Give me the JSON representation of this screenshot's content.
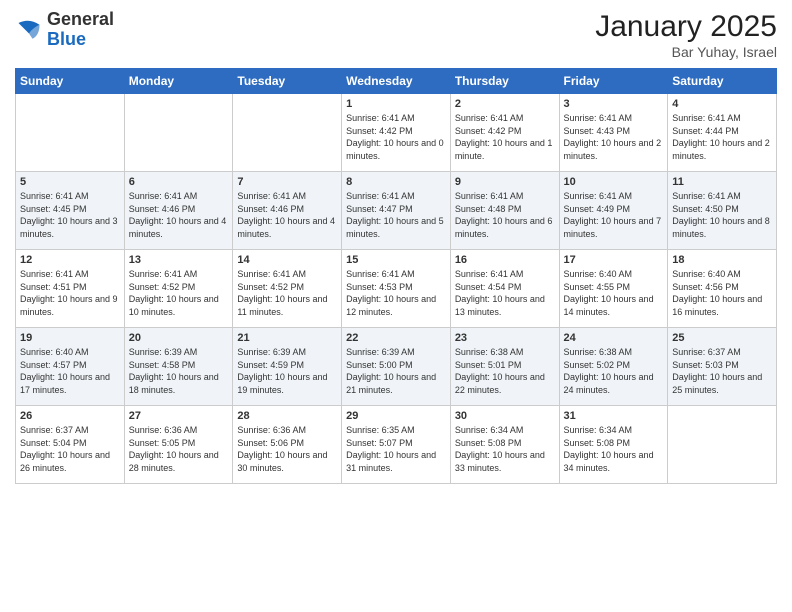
{
  "logo": {
    "general": "General",
    "blue": "Blue"
  },
  "header": {
    "title": "January 2025",
    "subtitle": "Bar Yuhay, Israel"
  },
  "weekdays": [
    "Sunday",
    "Monday",
    "Tuesday",
    "Wednesday",
    "Thursday",
    "Friday",
    "Saturday"
  ],
  "weeks": [
    [
      {
        "day": "",
        "sunrise": "",
        "sunset": "",
        "daylight": ""
      },
      {
        "day": "",
        "sunrise": "",
        "sunset": "",
        "daylight": ""
      },
      {
        "day": "",
        "sunrise": "",
        "sunset": "",
        "daylight": ""
      },
      {
        "day": "1",
        "sunrise": "Sunrise: 6:41 AM",
        "sunset": "Sunset: 4:42 PM",
        "daylight": "Daylight: 10 hours and 0 minutes."
      },
      {
        "day": "2",
        "sunrise": "Sunrise: 6:41 AM",
        "sunset": "Sunset: 4:42 PM",
        "daylight": "Daylight: 10 hours and 1 minute."
      },
      {
        "day": "3",
        "sunrise": "Sunrise: 6:41 AM",
        "sunset": "Sunset: 4:43 PM",
        "daylight": "Daylight: 10 hours and 2 minutes."
      },
      {
        "day": "4",
        "sunrise": "Sunrise: 6:41 AM",
        "sunset": "Sunset: 4:44 PM",
        "daylight": "Daylight: 10 hours and 2 minutes."
      }
    ],
    [
      {
        "day": "5",
        "sunrise": "Sunrise: 6:41 AM",
        "sunset": "Sunset: 4:45 PM",
        "daylight": "Daylight: 10 hours and 3 minutes."
      },
      {
        "day": "6",
        "sunrise": "Sunrise: 6:41 AM",
        "sunset": "Sunset: 4:46 PM",
        "daylight": "Daylight: 10 hours and 4 minutes."
      },
      {
        "day": "7",
        "sunrise": "Sunrise: 6:41 AM",
        "sunset": "Sunset: 4:46 PM",
        "daylight": "Daylight: 10 hours and 4 minutes."
      },
      {
        "day": "8",
        "sunrise": "Sunrise: 6:41 AM",
        "sunset": "Sunset: 4:47 PM",
        "daylight": "Daylight: 10 hours and 5 minutes."
      },
      {
        "day": "9",
        "sunrise": "Sunrise: 6:41 AM",
        "sunset": "Sunset: 4:48 PM",
        "daylight": "Daylight: 10 hours and 6 minutes."
      },
      {
        "day": "10",
        "sunrise": "Sunrise: 6:41 AM",
        "sunset": "Sunset: 4:49 PM",
        "daylight": "Daylight: 10 hours and 7 minutes."
      },
      {
        "day": "11",
        "sunrise": "Sunrise: 6:41 AM",
        "sunset": "Sunset: 4:50 PM",
        "daylight": "Daylight: 10 hours and 8 minutes."
      }
    ],
    [
      {
        "day": "12",
        "sunrise": "Sunrise: 6:41 AM",
        "sunset": "Sunset: 4:51 PM",
        "daylight": "Daylight: 10 hours and 9 minutes."
      },
      {
        "day": "13",
        "sunrise": "Sunrise: 6:41 AM",
        "sunset": "Sunset: 4:52 PM",
        "daylight": "Daylight: 10 hours and 10 minutes."
      },
      {
        "day": "14",
        "sunrise": "Sunrise: 6:41 AM",
        "sunset": "Sunset: 4:52 PM",
        "daylight": "Daylight: 10 hours and 11 minutes."
      },
      {
        "day": "15",
        "sunrise": "Sunrise: 6:41 AM",
        "sunset": "Sunset: 4:53 PM",
        "daylight": "Daylight: 10 hours and 12 minutes."
      },
      {
        "day": "16",
        "sunrise": "Sunrise: 6:41 AM",
        "sunset": "Sunset: 4:54 PM",
        "daylight": "Daylight: 10 hours and 13 minutes."
      },
      {
        "day": "17",
        "sunrise": "Sunrise: 6:40 AM",
        "sunset": "Sunset: 4:55 PM",
        "daylight": "Daylight: 10 hours and 14 minutes."
      },
      {
        "day": "18",
        "sunrise": "Sunrise: 6:40 AM",
        "sunset": "Sunset: 4:56 PM",
        "daylight": "Daylight: 10 hours and 16 minutes."
      }
    ],
    [
      {
        "day": "19",
        "sunrise": "Sunrise: 6:40 AM",
        "sunset": "Sunset: 4:57 PM",
        "daylight": "Daylight: 10 hours and 17 minutes."
      },
      {
        "day": "20",
        "sunrise": "Sunrise: 6:39 AM",
        "sunset": "Sunset: 4:58 PM",
        "daylight": "Daylight: 10 hours and 18 minutes."
      },
      {
        "day": "21",
        "sunrise": "Sunrise: 6:39 AM",
        "sunset": "Sunset: 4:59 PM",
        "daylight": "Daylight: 10 hours and 19 minutes."
      },
      {
        "day": "22",
        "sunrise": "Sunrise: 6:39 AM",
        "sunset": "Sunset: 5:00 PM",
        "daylight": "Daylight: 10 hours and 21 minutes."
      },
      {
        "day": "23",
        "sunrise": "Sunrise: 6:38 AM",
        "sunset": "Sunset: 5:01 PM",
        "daylight": "Daylight: 10 hours and 22 minutes."
      },
      {
        "day": "24",
        "sunrise": "Sunrise: 6:38 AM",
        "sunset": "Sunset: 5:02 PM",
        "daylight": "Daylight: 10 hours and 24 minutes."
      },
      {
        "day": "25",
        "sunrise": "Sunrise: 6:37 AM",
        "sunset": "Sunset: 5:03 PM",
        "daylight": "Daylight: 10 hours and 25 minutes."
      }
    ],
    [
      {
        "day": "26",
        "sunrise": "Sunrise: 6:37 AM",
        "sunset": "Sunset: 5:04 PM",
        "daylight": "Daylight: 10 hours and 26 minutes."
      },
      {
        "day": "27",
        "sunrise": "Sunrise: 6:36 AM",
        "sunset": "Sunset: 5:05 PM",
        "daylight": "Daylight: 10 hours and 28 minutes."
      },
      {
        "day": "28",
        "sunrise": "Sunrise: 6:36 AM",
        "sunset": "Sunset: 5:06 PM",
        "daylight": "Daylight: 10 hours and 30 minutes."
      },
      {
        "day": "29",
        "sunrise": "Sunrise: 6:35 AM",
        "sunset": "Sunset: 5:07 PM",
        "daylight": "Daylight: 10 hours and 31 minutes."
      },
      {
        "day": "30",
        "sunrise": "Sunrise: 6:34 AM",
        "sunset": "Sunset: 5:08 PM",
        "daylight": "Daylight: 10 hours and 33 minutes."
      },
      {
        "day": "31",
        "sunrise": "Sunrise: 6:34 AM",
        "sunset": "Sunset: 5:08 PM",
        "daylight": "Daylight: 10 hours and 34 minutes."
      },
      {
        "day": "",
        "sunrise": "",
        "sunset": "",
        "daylight": ""
      }
    ]
  ]
}
